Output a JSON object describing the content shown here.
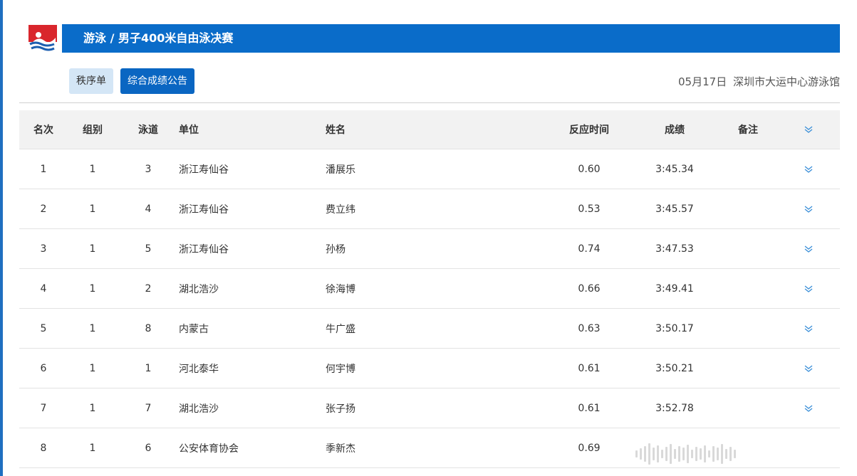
{
  "header": {
    "title": "游泳 / 男子400米自由泳决赛",
    "logo_icon": "swimming-logo-icon",
    "banner_color": "#0a6cc9"
  },
  "toolbar": {
    "order_label": "秩序单",
    "results_label": "综合成绩公告"
  },
  "meta": {
    "date": "05月17日",
    "venue": "深圳市大运中心游泳馆"
  },
  "table": {
    "columns": {
      "rank": "名次",
      "group": "组别",
      "lane": "泳道",
      "unit": "单位",
      "name": "姓名",
      "reaction": "反应时间",
      "result": "成绩",
      "note": "备注"
    },
    "rows": [
      {
        "rank": "1",
        "group": "1",
        "lane": "3",
        "unit": "浙江寿仙谷",
        "name": "潘展乐",
        "reaction": "0.60",
        "result": "3:45.34",
        "note": ""
      },
      {
        "rank": "2",
        "group": "1",
        "lane": "4",
        "unit": "浙江寿仙谷",
        "name": "费立纬",
        "reaction": "0.53",
        "result": "3:45.57",
        "note": ""
      },
      {
        "rank": "3",
        "group": "1",
        "lane": "5",
        "unit": "浙江寿仙谷",
        "name": "孙杨",
        "reaction": "0.74",
        "result": "3:47.53",
        "note": ""
      },
      {
        "rank": "4",
        "group": "1",
        "lane": "2",
        "unit": "湖北浩沙",
        "name": "徐海博",
        "reaction": "0.66",
        "result": "3:49.41",
        "note": ""
      },
      {
        "rank": "5",
        "group": "1",
        "lane": "8",
        "unit": "内蒙古",
        "name": "牛广盛",
        "reaction": "0.63",
        "result": "3:50.17",
        "note": ""
      },
      {
        "rank": "6",
        "group": "1",
        "lane": "1",
        "unit": "河北泰华",
        "name": "何宇博",
        "reaction": "0.61",
        "result": "3:50.21",
        "note": ""
      },
      {
        "rank": "7",
        "group": "1",
        "lane": "7",
        "unit": "湖北浩沙",
        "name": "张子扬",
        "reaction": "0.61",
        "result": "3:52.78",
        "note": ""
      },
      {
        "rank": "8",
        "group": "1",
        "lane": "6",
        "unit": "公安体育协会",
        "name": "季新杰",
        "reaction": "0.69",
        "result": "",
        "note": ""
      }
    ]
  },
  "colors": {
    "accent": "#0a6cc9",
    "chevron": "#3a8fd8"
  }
}
